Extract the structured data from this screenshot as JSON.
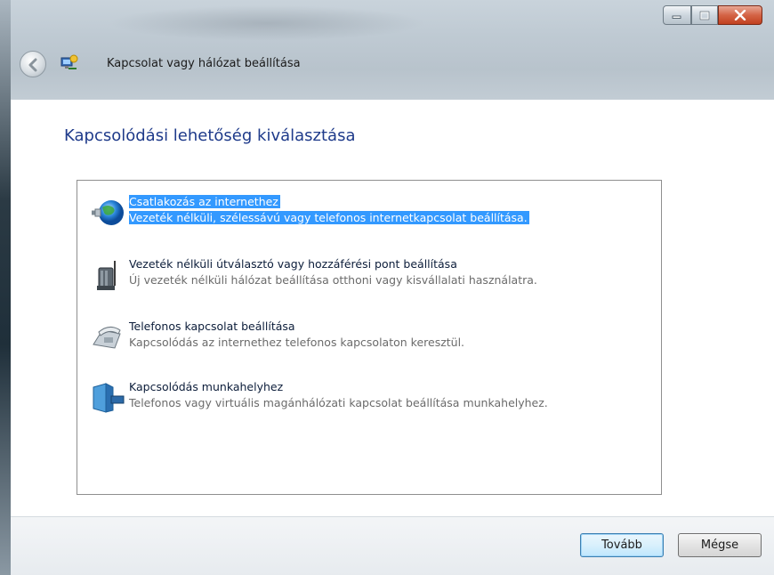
{
  "window": {
    "title": "Kapcsolat vagy hálózat beállítása"
  },
  "page": {
    "heading": "Kapcsolódási lehetőség kiválasztása"
  },
  "options": [
    {
      "title": "Csatlakozás az internethez",
      "description": "Vezeték nélküli, szélessávú vagy telefonos internetkapcsolat beállítása.",
      "icon": "globe-connect-icon",
      "selected": true
    },
    {
      "title": "Vezeték nélküli útválasztó vagy hozzáférési pont beállítása",
      "description": "Új vezeték nélküli hálózat beállítása otthoni vagy kisvállalati használatra.",
      "icon": "wireless-router-icon",
      "selected": false
    },
    {
      "title": "Telefonos kapcsolat beállítása",
      "description": "Kapcsolódás az internethez telefonos kapcsolaton keresztül.",
      "icon": "dialup-phone-icon",
      "selected": false
    },
    {
      "title": "Kapcsolódás munkahelyhez",
      "description": "Telefonos vagy virtuális magánhálózati kapcsolat beállítása munkahelyhez.",
      "icon": "workplace-building-icon",
      "selected": false
    }
  ],
  "buttons": {
    "next": "Tovább",
    "cancel": "Mégse"
  },
  "colors": {
    "selection": "#3399ff",
    "heading": "#1e3a8a"
  }
}
